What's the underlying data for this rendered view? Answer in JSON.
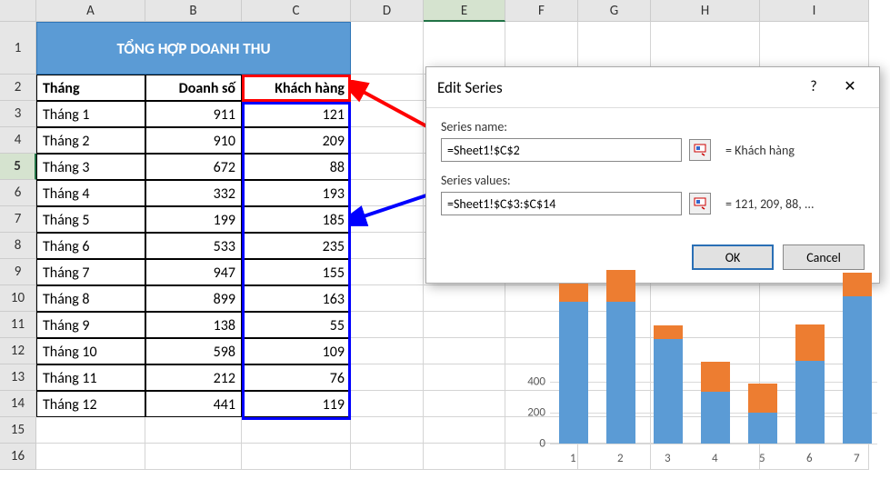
{
  "columns": [
    "A",
    "B",
    "C",
    "D",
    "E",
    "F",
    "G",
    "H",
    "I"
  ],
  "active_col": "E",
  "active_row": 5,
  "title": "TỔNG HỢP DOANH THU",
  "headers": {
    "A": "Tháng",
    "B": "Doanh số",
    "C": "Khách hàng"
  },
  "data": [
    {
      "thang": "Tháng 1",
      "ds": 911,
      "kh": 121
    },
    {
      "thang": "Tháng 2",
      "ds": 910,
      "kh": 209
    },
    {
      "thang": "Tháng 3",
      "ds": 672,
      "kh": 88
    },
    {
      "thang": "Tháng 4",
      "ds": 332,
      "kh": 193
    },
    {
      "thang": "Tháng 5",
      "ds": 199,
      "kh": 185
    },
    {
      "thang": "Tháng 6",
      "ds": 533,
      "kh": 235
    },
    {
      "thang": "Tháng 7",
      "ds": 947,
      "kh": 155
    },
    {
      "thang": "Tháng 8",
      "ds": 899,
      "kh": 163
    },
    {
      "thang": "Tháng 9",
      "ds": 138,
      "kh": 55
    },
    {
      "thang": "Tháng 10",
      "ds": 598,
      "kh": 109
    },
    {
      "thang": "Tháng 11",
      "ds": 212,
      "kh": 76
    },
    {
      "thang": "Tháng 12",
      "ds": 441,
      "kh": 119
    }
  ],
  "dialog": {
    "title": "Edit Series",
    "help": "?",
    "close": "✕",
    "series_name_label": "Series name:",
    "series_name_value": "=Sheet1!$C$2",
    "series_name_result": "= Khách hàng",
    "series_values_label": "Series values:",
    "series_values_value": "=Sheet1!$C$3:$C$14",
    "series_values_result": "= 121, 209, 88, ...",
    "ok": "OK",
    "cancel": "Cancel"
  },
  "chart_data": {
    "type": "bar",
    "categories": [
      1,
      2,
      3,
      4,
      5,
      6,
      7
    ],
    "series": [
      {
        "name": "Doanh số",
        "values": [
          911,
          910,
          672,
          332,
          199,
          533,
          947
        ],
        "color": "#5b9bd5"
      },
      {
        "name": "Khách hàng",
        "values": [
          121,
          209,
          88,
          193,
          185,
          235,
          155
        ],
        "color": "#ed7d31"
      }
    ],
    "y_ticks": [
      0,
      200,
      400
    ],
    "xlabel": "",
    "ylabel": "",
    "visible_ymax": 1100
  }
}
